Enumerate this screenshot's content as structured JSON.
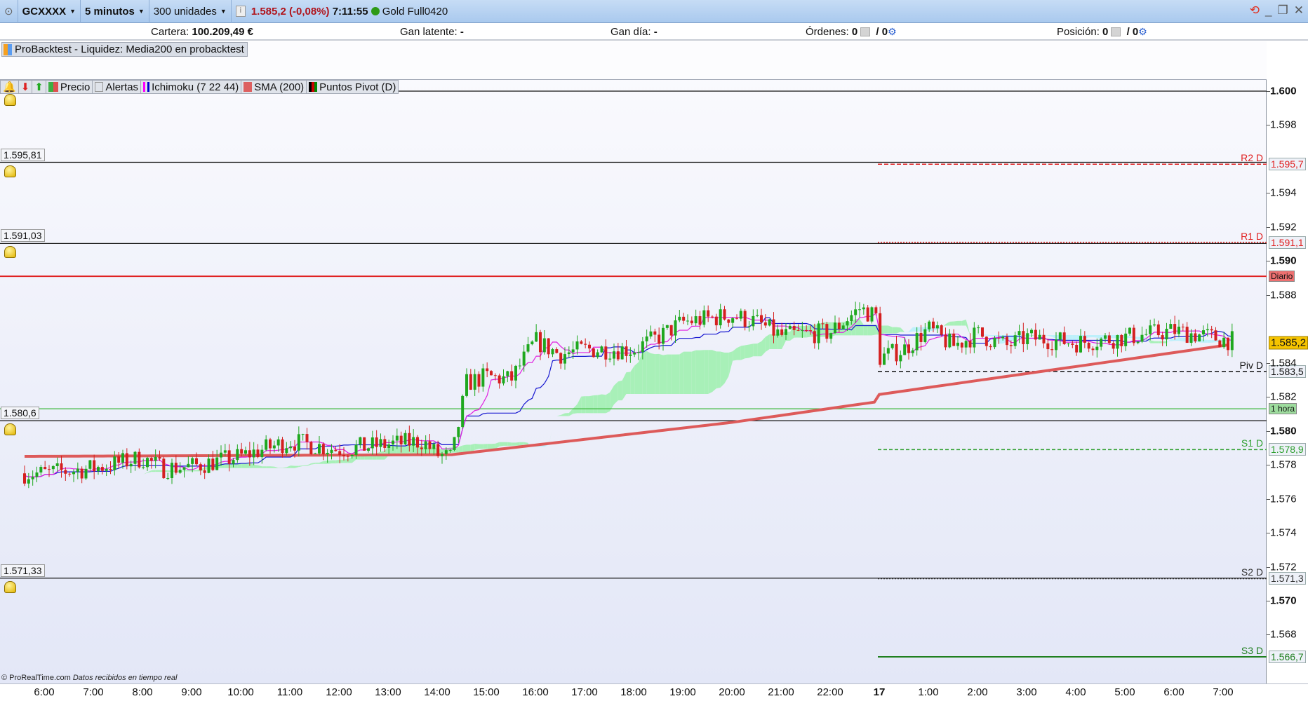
{
  "topbar": {
    "symbol": "GCXXXX",
    "timeframe": "5 minutos",
    "units": "300 unidades",
    "price": "1.585,2 (-0,08%)",
    "time": "7:11:55",
    "instrument": "Gold Full0420"
  },
  "infobar": {
    "cartera_label": "Cartera:",
    "cartera_value": "100.209,49 €",
    "latente_label": "Gan latente:",
    "latente_value": "-",
    "dia_label": "Gan día:",
    "dia_value": "-",
    "ordenes_label": "Órdenes:",
    "ordenes_a": "0",
    "ordenes_b": "/ 0",
    "posicion_label": "Posición:",
    "posicion_a": "0",
    "posicion_b": "/ 0"
  },
  "backtest": {
    "label": "ProBacktest - Liquidez: Media200 en probacktest"
  },
  "legend": [
    "Precio",
    "Alertas",
    "Ichimoku (7 22 44)",
    "SMA (200)",
    "Puntos Pivot (D)"
  ],
  "alert_lines": [
    {
      "label": "1.595,81",
      "price": 1.59581
    },
    {
      "label": "1.591,03",
      "price": 1.59103
    },
    {
      "label": "1.580,6",
      "price": 1.5806
    },
    {
      "label": "1.571,33",
      "price": 1.57133
    }
  ],
  "timeframe_lines": [
    {
      "label": "Diario",
      "price": 1.5891,
      "color": "#e02020"
    },
    {
      "label": "1 hora",
      "price": 1.5813,
      "color": "#3db83d"
    }
  ],
  "pivots": [
    {
      "name": "R2 D",
      "label": "1.595,7",
      "price": 1.5957,
      "color": "#e02020",
      "dash": "6,3"
    },
    {
      "name": "R1 D",
      "label": "1.591,1",
      "price": 1.5911,
      "color": "#e02020",
      "dash": "2,2"
    },
    {
      "name": "Piv D",
      "label": "1.583,5",
      "price": 1.5835,
      "color": "#111111",
      "dash": "6,4"
    },
    {
      "name": "S1 D",
      "label": "1.578,9",
      "price": 1.5789,
      "color": "#2fa02f",
      "dash": "5,3"
    },
    {
      "name": "S2 D",
      "label": "1.571,3",
      "price": 1.5713,
      "color": "#333333",
      "dash": "2,2"
    },
    {
      "name": "S3 D",
      "label": "1.566,7",
      "price": 1.5667,
      "color": "#1f7f1f",
      "dash": ""
    }
  ],
  "price_axis": [
    {
      "v": "1.600",
      "p": 1.6,
      "b": true
    },
    {
      "v": "1.598",
      "p": 1.598
    },
    {
      "v": "1.594",
      "p": 1.594
    },
    {
      "v": "1.592",
      "p": 1.592
    },
    {
      "v": "1.590",
      "p": 1.59,
      "b": true
    },
    {
      "v": "1.588",
      "p": 1.588
    },
    {
      "v": "1.584",
      "p": 1.584
    },
    {
      "v": "1.582",
      "p": 1.582
    },
    {
      "v": "1.580",
      "p": 1.58,
      "b": true
    },
    {
      "v": "1.578",
      "p": 1.578
    },
    {
      "v": "1.576",
      "p": 1.576
    },
    {
      "v": "1.574",
      "p": 1.574
    },
    {
      "v": "1.572",
      "p": 1.572
    },
    {
      "v": "1.570",
      "p": 1.57,
      "b": true
    },
    {
      "v": "1.568",
      "p": 1.568
    }
  ],
  "current_price": {
    "label": "1.585,2",
    "price": 1.5852
  },
  "time_axis": [
    {
      "l": "6:00",
      "t": 6
    },
    {
      "l": "7:00",
      "t": 7
    },
    {
      "l": "8:00",
      "t": 8
    },
    {
      "l": "9:00",
      "t": 9
    },
    {
      "l": "10:00",
      "t": 10
    },
    {
      "l": "11:00",
      "t": 11
    },
    {
      "l": "12:00",
      "t": 12
    },
    {
      "l": "13:00",
      "t": 13
    },
    {
      "l": "14:00",
      "t": 14
    },
    {
      "l": "15:00",
      "t": 15
    },
    {
      "l": "16:00",
      "t": 16
    },
    {
      "l": "17:00",
      "t": 17
    },
    {
      "l": "18:00",
      "t": 18
    },
    {
      "l": "19:00",
      "t": 19
    },
    {
      "l": "20:00",
      "t": 20
    },
    {
      "l": "21:00",
      "t": 21
    },
    {
      "l": "22:00",
      "t": 22
    },
    {
      "l": "17",
      "t": 24,
      "b": true
    },
    {
      "l": "1:00",
      "t": 25
    },
    {
      "l": "2:00",
      "t": 26
    },
    {
      "l": "3:00",
      "t": 27
    },
    {
      "l": "4:00",
      "t": 28
    },
    {
      "l": "5:00",
      "t": 29
    },
    {
      "l": "6:00",
      "t": 30
    },
    {
      "l": "7:00",
      "t": 31
    }
  ],
  "chart_data": {
    "type": "candlestick",
    "interval_min": 5,
    "price_path": [
      [
        5.6,
        1.5775
      ],
      [
        6,
        1.5775
      ],
      [
        7,
        1.5778
      ],
      [
        8,
        1.5784
      ],
      [
        8.4,
        1.5778
      ],
      [
        9,
        1.5779
      ],
      [
        10,
        1.5785
      ],
      [
        11,
        1.5794
      ],
      [
        12,
        1.5789
      ],
      [
        13,
        1.5792
      ],
      [
        13.7,
        1.5794
      ],
      [
        14,
        1.5786
      ],
      [
        14.3,
        1.5784
      ],
      [
        14.6,
        1.5828
      ],
      [
        15,
        1.5832
      ],
      [
        15.5,
        1.583
      ],
      [
        16,
        1.5853
      ],
      [
        16.5,
        1.5845
      ],
      [
        17,
        1.5848
      ],
      [
        18,
        1.5848
      ],
      [
        18.5,
        1.5855
      ],
      [
        19,
        1.5864
      ],
      [
        20,
        1.5868
      ],
      [
        20.5,
        1.5864
      ],
      [
        21,
        1.5856
      ],
      [
        22,
        1.5858
      ],
      [
        22.6,
        1.5872
      ],
      [
        22.9,
        1.5868
      ],
      [
        24,
        1.5843
      ],
      [
        24.5,
        1.5848
      ],
      [
        25,
        1.586
      ],
      [
        25.5,
        1.585
      ],
      [
        26,
        1.5857
      ],
      [
        26.6,
        1.585
      ],
      [
        27,
        1.5855
      ],
      [
        28,
        1.5852
      ],
      [
        29,
        1.5855
      ],
      [
        30,
        1.5859
      ],
      [
        31.2,
        1.5853
      ]
    ],
    "sma200": [
      [
        5.6,
        1.5785
      ],
      [
        14.3,
        1.5786
      ],
      [
        20,
        1.5805
      ],
      [
        31.2,
        1.5851
      ]
    ]
  },
  "footer": {
    "copyright": "© ProRealTime.com",
    "status": "Datos recibidos en tiempo real"
  }
}
